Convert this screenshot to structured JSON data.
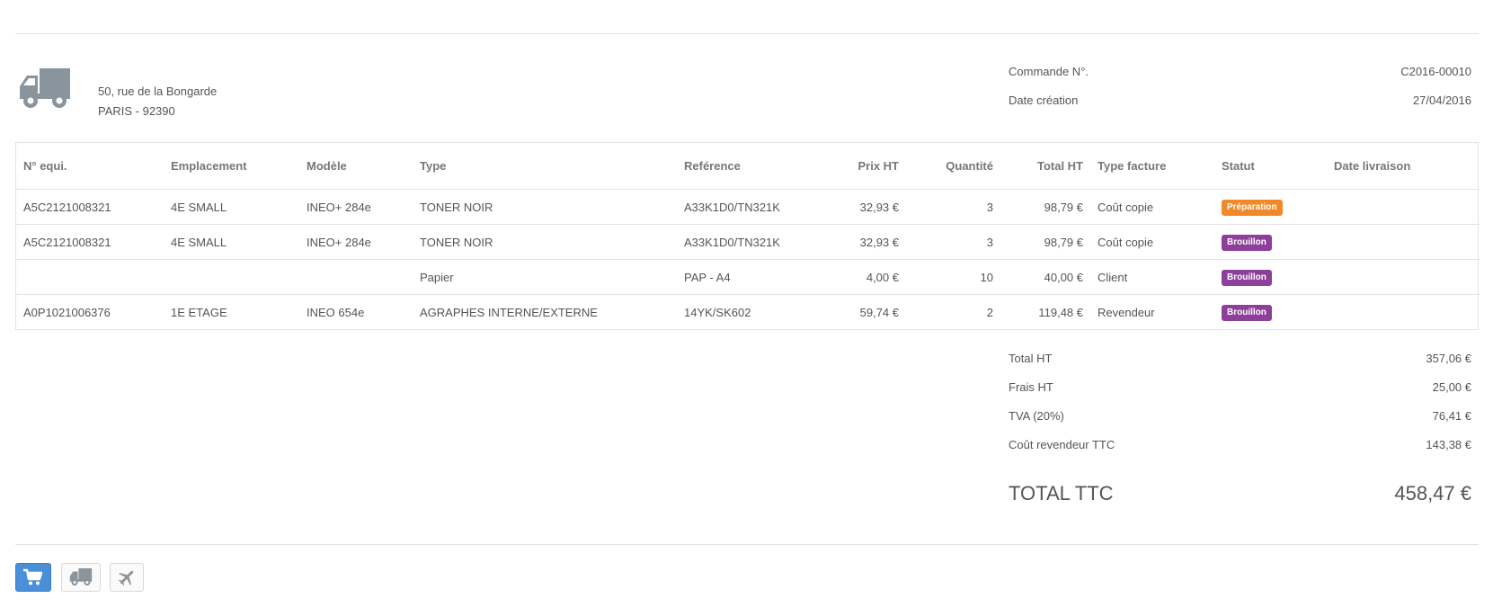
{
  "address": {
    "line1": "50, rue de la Bongarde",
    "line2": "PARIS - 92390"
  },
  "order": {
    "number_label": "Commande N°.",
    "number_value": "C2016-00010",
    "date_label": "Date création",
    "date_value": "27/04/2016"
  },
  "table": {
    "headers": [
      "N° equi.",
      "Emplacement",
      "Modèle",
      "Type",
      "Reférence",
      "Prix HT",
      "Quantité",
      "Total HT",
      "Type facture",
      "Statut",
      "Date livraison"
    ],
    "rows": [
      {
        "equip": "A5C2121008321",
        "location": "4E SMALL",
        "model": "INEO+ 284e",
        "type": "TONER NOIR",
        "reference": "A33K1D0/TN321K",
        "price": "32,93 €",
        "qty": "3",
        "total": "98,79 €",
        "invoice_type": "Coût copie",
        "status": "Préparation",
        "status_color": "#f0892a",
        "delivery": ""
      },
      {
        "equip": "A5C2121008321",
        "location": "4E SMALL",
        "model": "INEO+ 284e",
        "type": "TONER NOIR",
        "reference": "A33K1D0/TN321K",
        "price": "32,93 €",
        "qty": "3",
        "total": "98,79 €",
        "invoice_type": "Coût copie",
        "status": "Brouillon",
        "status_color": "#8e3f9b",
        "delivery": ""
      },
      {
        "equip": "",
        "location": "",
        "model": "",
        "type": "Papier",
        "reference": "PAP - A4",
        "price": "4,00 €",
        "qty": "10",
        "total": "40,00 €",
        "invoice_type": "Client",
        "status": "Brouillon",
        "status_color": "#8e3f9b",
        "delivery": ""
      },
      {
        "equip": "A0P1021006376",
        "location": "1E ETAGE",
        "model": "INEO 654e",
        "type": "AGRAPHES INTERNE/EXTERNE",
        "reference": "14YK/SK602",
        "price": "59,74 €",
        "qty": "2",
        "total": "119,48 €",
        "invoice_type": "Revendeur",
        "status": "Brouillon",
        "status_color": "#8e3f9b",
        "delivery": ""
      }
    ]
  },
  "totals": {
    "total_ht_label": "Total HT",
    "total_ht_value": "357,06 €",
    "frais_label": "Frais HT",
    "frais_value": "25,00 €",
    "tva_label": "TVA (20%)",
    "tva_value": "76,41 €",
    "revendeur_label": "Coût revendeur TTC",
    "revendeur_value": "143,38 €",
    "ttc_label": "TOTAL TTC",
    "ttc_value": "458,47 €"
  },
  "toolbar": {
    "buttons": [
      {
        "icon": "cart-icon",
        "active": true
      },
      {
        "icon": "truck-icon",
        "active": false
      },
      {
        "icon": "plane-icon",
        "active": false
      }
    ]
  },
  "colors": {
    "accent": "#4a8fd8",
    "preparation": "#f0892a",
    "brouillon": "#8e3f9b",
    "icon_gray": "#8a949c"
  }
}
